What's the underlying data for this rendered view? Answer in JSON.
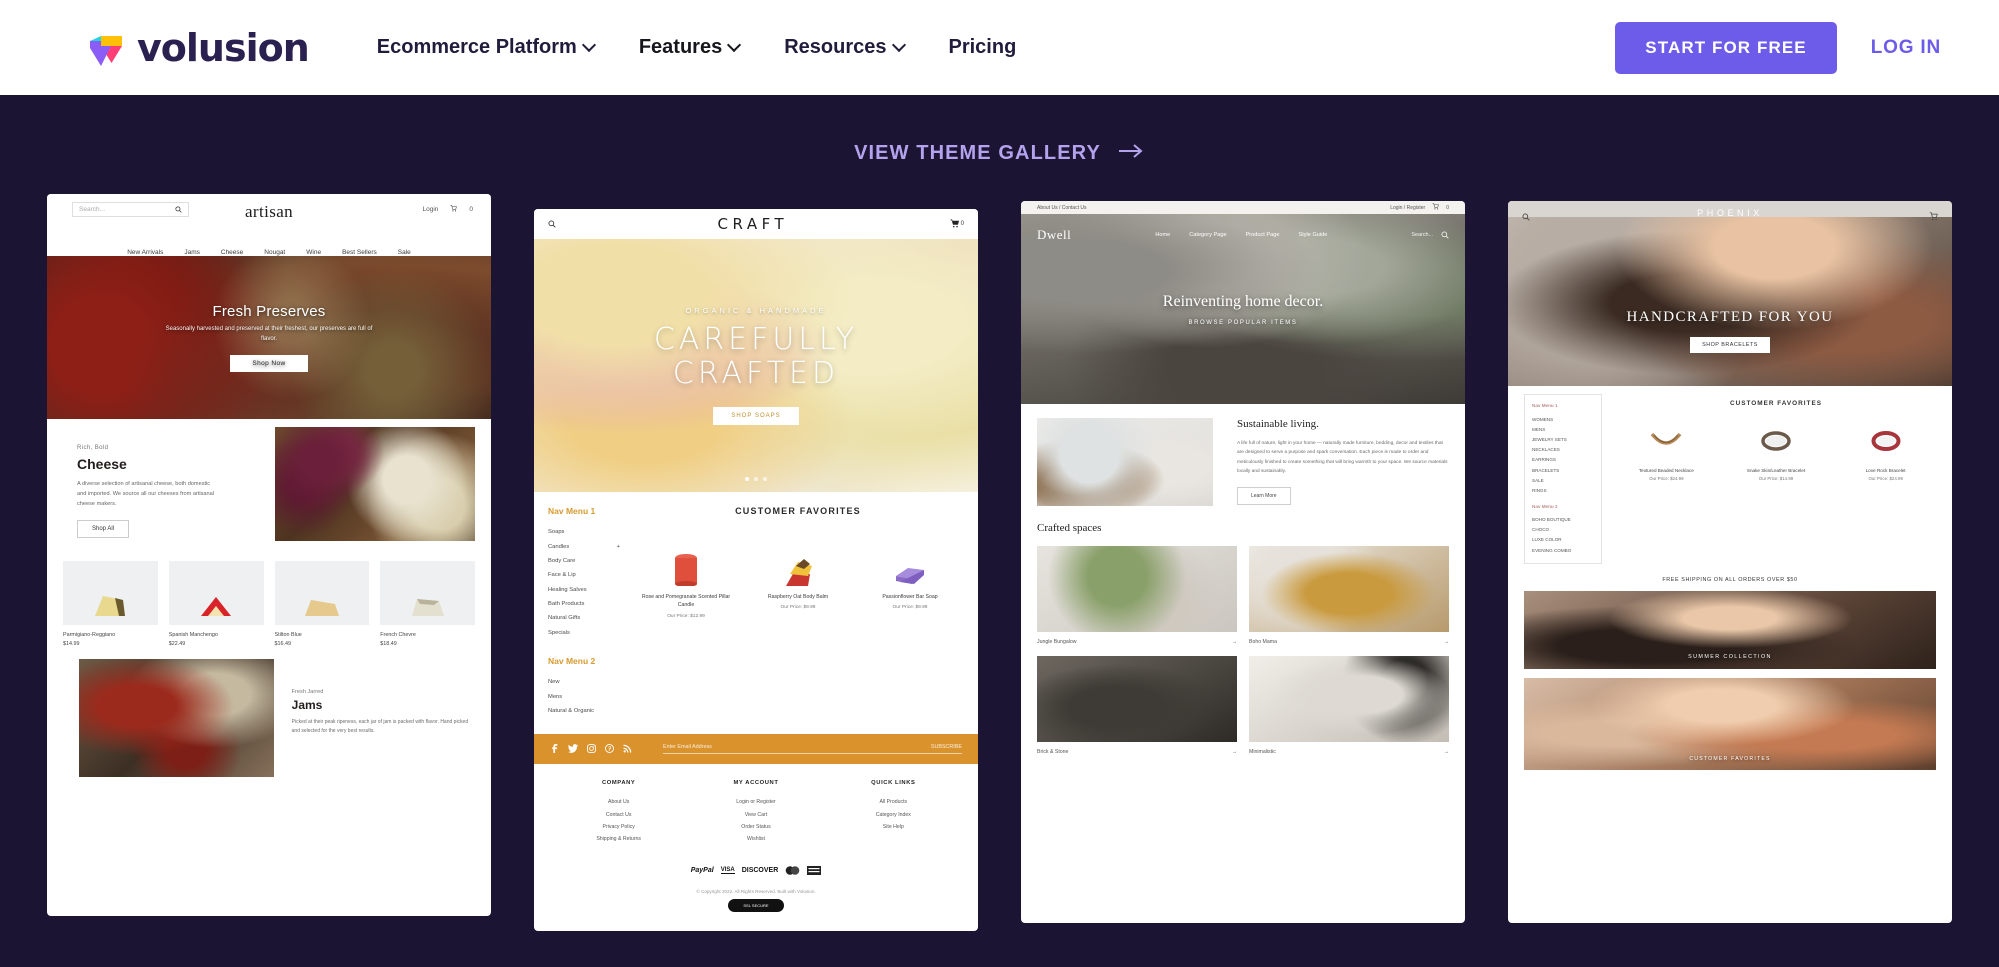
{
  "header": {
    "brand": "volusion",
    "nav": [
      {
        "label": "Ecommerce Platform",
        "has_caret": true
      },
      {
        "label": "Features",
        "has_caret": true
      },
      {
        "label": "Resources",
        "has_caret": true
      },
      {
        "label": "Pricing",
        "has_caret": false
      }
    ],
    "cta_primary": "START FOR FREE",
    "cta_secondary": "LOG IN",
    "accent_color": "#6C5CE9",
    "brand_color": "#2B2150"
  },
  "gallery": {
    "link_label": "VIEW THEME GALLERY",
    "arrow_icon": "arrow-right-icon",
    "background": "#1B1533",
    "link_color": "#B3A3EE"
  },
  "themes": [
    {
      "id": "artisan",
      "name": "artisan",
      "search_placeholder": "Search...",
      "account_links": [
        "Login"
      ],
      "cart_count": "0",
      "nav": [
        "New Arrivals",
        "Jams",
        "Cheese",
        "Nougat",
        "Wine",
        "Best Sellers",
        "Sale"
      ],
      "hero": {
        "title": "Fresh Preserves",
        "subtitle": "Seasonally harvested and preserved at their freshest, our preserves are full of flavor.",
        "button": "Shop Now"
      },
      "cheese": {
        "kicker": "Rich, Bold",
        "title": "Cheese",
        "body": "A diverse selection of artisanal cheese, both domestic and imported. We source all our cheeses from artisanal cheese makers.",
        "button": "Shop All"
      },
      "products": [
        {
          "name": "Parmigiano-Reggiano",
          "price": "$14.99"
        },
        {
          "name": "Spanish Manchengo",
          "price": "$22.49"
        },
        {
          "name": "Stilton Blue",
          "price": "$16.49"
        },
        {
          "name": "French Chevre",
          "price": "$18.49"
        }
      ],
      "jams": {
        "kicker": "Fresh Jarred",
        "title": "Jams",
        "body": "Picked at their peak ripeness, each jar of jam is packed with flavor. Hand picked and selected for the very best results."
      }
    },
    {
      "id": "craft",
      "name": "CRAFT",
      "cart_count": "0",
      "hero": {
        "kicker": "ORGANIC & HANDMADE",
        "line1": "CAREFULLY",
        "line2": "CRAFTED",
        "button": "SHOP SOAPS"
      },
      "nav_menu_1_title": "Nav Menu 1",
      "nav_menu_1": [
        "Soaps",
        "Candles",
        "Body Care",
        "Face & Lip",
        "Healing Salves",
        "Bath Products",
        "Natural Gifts",
        "Specials"
      ],
      "nav_menu_2_title": "Nav Menu 2",
      "nav_menu_2": [
        "New",
        "Mens",
        "Natural & Organic"
      ],
      "favorites_title": "CUSTOMER FAVORITES",
      "products": [
        {
          "name": "Rose and Pomegranate Scented Pillar Candle",
          "price": "Our Price: $12.99"
        },
        {
          "name": "Raspberry Oat Body Balm",
          "price": "Our Price: $9.99"
        },
        {
          "name": "Passionflower Bar Soap",
          "price": "Our Price: $9.99"
        }
      ],
      "newsletter": {
        "placeholder": "Enter Email Address",
        "button": "SUBSCRIBE"
      },
      "social": [
        "facebook-icon",
        "twitter-icon",
        "instagram-icon",
        "pinterest-icon",
        "rss-icon"
      ],
      "footer_columns": [
        {
          "title": "COMPANY",
          "links": [
            "About Us",
            "Contact Us",
            "Privacy Policy",
            "Shipping & Returns"
          ]
        },
        {
          "title": "MY ACCOUNT",
          "links": [
            "Login or Register",
            "View Cart",
            "Order Status",
            "Wishlist"
          ]
        },
        {
          "title": "QUICK LINKS",
          "links": [
            "All Products",
            "Category Index",
            "Site Help"
          ]
        }
      ],
      "payments": [
        "PayPal",
        "VISA",
        "DISCOVER",
        "MasterCard",
        "AmEx"
      ],
      "copyright": "© Copyright 2022. All Rights Reserved. Built with Volusion.",
      "badge": "SSL SECURE"
    },
    {
      "id": "dwell",
      "name": "Dwell",
      "topbar_left": "About Us / Contact Us",
      "topbar_right": "Login / Register",
      "cart_count": "0",
      "nav": [
        "Home",
        "Category Page",
        "Product Page",
        "Style Guide"
      ],
      "search_placeholder": "Search...",
      "hero": {
        "title": "Reinventing home decor.",
        "cta": "BROWSE POPULAR ITEMS"
      },
      "sustainable": {
        "title": "Sustainable living.",
        "body": "A life full of nature, light in your home — naturally made furniture, bedding, decor and textiles that are designed to serve a purpose and spark conversation. Each piece is made to order and meticulously finished to create something that will bring warmth to your space. We source materials locally and sustainably.",
        "button": "Learn More"
      },
      "crafted": {
        "title": "Crafted spaces",
        "cells": [
          {
            "label": "Jungle Bungalow",
            "arrow": "→"
          },
          {
            "label": "Boho Mama",
            "arrow": "→"
          },
          {
            "label": "Brick & Stone",
            "arrow": "→"
          },
          {
            "label": "Minimalistic",
            "arrow": "→"
          }
        ]
      }
    },
    {
      "id": "phoenix",
      "name": "PHOENIX",
      "cart_count": "0",
      "hero": {
        "title": "HANDCRAFTED FOR YOU",
        "button": "SHOP BRACELETS"
      },
      "nav_menu_1_title": "Nav Menu 1",
      "nav_menu_1": [
        "WOMENS",
        "MENS",
        "JEWELRY SETS",
        "NECKLACES",
        "EARRINGS",
        "BRACELETS",
        "SALE",
        "RINGS"
      ],
      "nav_menu_2_title": "Nav Menu 2",
      "nav_menu_2": [
        "BOHO BOUTIQUE",
        "CHOCO",
        "LUXE COLOR",
        "EVENING COMBO"
      ],
      "favorites_title": "CUSTOMER FAVORITES",
      "products": [
        {
          "name": "Textured Beaded Necklace",
          "price": "Our Price: $24.99"
        },
        {
          "name": "Snake Skin/Leather Bracelet",
          "price": "Our Price: $14.99"
        },
        {
          "name": "Love Rock Bracelet",
          "price": "Our Price: $24.99"
        }
      ],
      "shipping_banner": "FREE SHIPPING ON ALL ORDERS OVER $50",
      "banner_1": "SUMMER COLLECTION",
      "banner_2": "CUSTOMER FAVORITES"
    }
  ]
}
